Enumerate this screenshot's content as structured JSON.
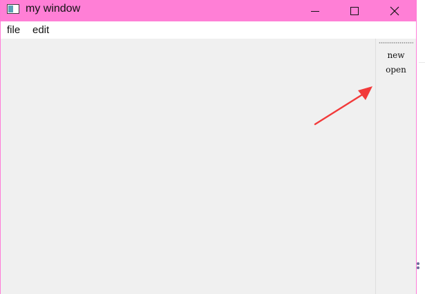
{
  "window": {
    "title": "my window"
  },
  "menubar": {
    "items": [
      {
        "label": "file"
      },
      {
        "label": "edit"
      }
    ]
  },
  "toolbar": {
    "items": [
      {
        "label": "new"
      },
      {
        "label": "open"
      }
    ]
  },
  "icons": {
    "app": "app-window-icon",
    "minimize": "minimize-icon",
    "maximize": "maximize-icon",
    "close": "close-icon",
    "annotation": "red-arrow-annotation"
  },
  "colors": {
    "titlebar": "#ff7fd6",
    "window_border": "#ff7bd7",
    "menubar": "#ffffff",
    "client_area": "#f0f0f0",
    "annotation_arrow": "#f23a3a"
  }
}
